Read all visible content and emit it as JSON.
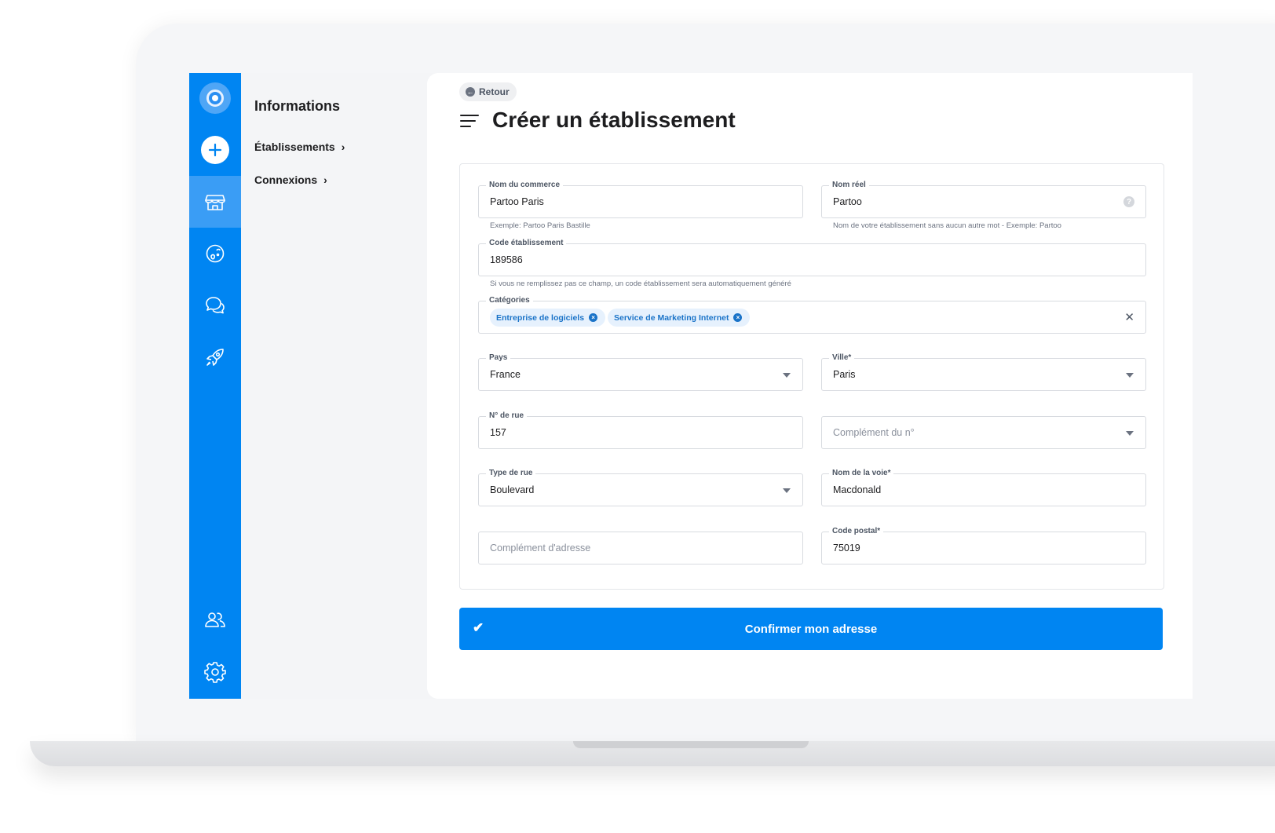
{
  "colors": {
    "brand": "#0085f2",
    "rail_active": "#3a9df5",
    "chip_bg": "#e6f1fd",
    "chip_text": "#1a73c8"
  },
  "rail": {
    "icons": [
      "logo-icon",
      "plus-icon",
      "store-icon",
      "globe-icon",
      "chat-bubbles-icon",
      "rocket-icon",
      "users-icon",
      "gear-icon"
    ]
  },
  "menu": {
    "title": "Informations",
    "items": [
      {
        "label": "Établissements",
        "chevron": "›"
      },
      {
        "label": "Connexions",
        "chevron": "›"
      }
    ]
  },
  "header": {
    "back_label": "Retour",
    "title": "Créer un établissement"
  },
  "form": {
    "commerce": {
      "label": "Nom du commerce",
      "value": "Partoo Paris",
      "hint": "Exemple: Partoo Paris Bastille"
    },
    "nom_reel": {
      "label": "Nom réel",
      "value": "Partoo",
      "hint": "Nom de votre établissement sans aucun autre mot - Exemple: Partoo",
      "help": "?"
    },
    "code": {
      "label": "Code établissement",
      "value": "189586",
      "hint": "Si vous ne remplissez pas ce champ, un code établissement sera automatiquement généré"
    },
    "categories": {
      "label": "Catégories",
      "chips": [
        "Entreprise de logiciels",
        "Service de Marketing Internet"
      ],
      "chip_remove": "×",
      "clear": "✕"
    },
    "pays": {
      "label": "Pays",
      "value": "France"
    },
    "ville": {
      "label": "Ville*",
      "value": "Paris"
    },
    "numero": {
      "label": "N° de rue",
      "value": "157"
    },
    "complement_numero": {
      "placeholder": "Complément du n°"
    },
    "type_rue": {
      "label": "Type de rue",
      "value": "Boulevard"
    },
    "voie": {
      "label": "Nom de la voie*",
      "value": "Macdonald"
    },
    "complement_adresse": {
      "placeholder": "Complément d'adresse"
    },
    "code_postal": {
      "label": "Code postal*",
      "value": "75019"
    }
  },
  "confirm": {
    "label": "Confirmer mon adresse",
    "check": "✔"
  }
}
